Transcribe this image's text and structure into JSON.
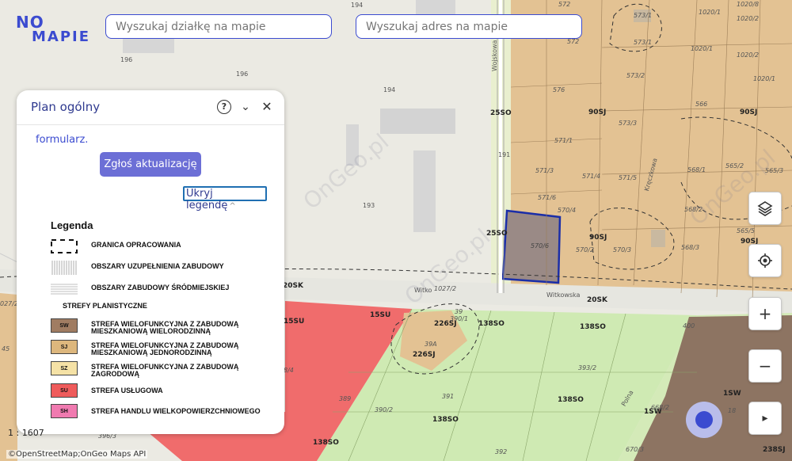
{
  "logo": {
    "top": "NO",
    "bottom": "MAPIE"
  },
  "search": {
    "plot_placeholder": "Wyszukaj działkę na mapie",
    "address_placeholder": "Wyszukaj adres na mapie"
  },
  "panel": {
    "title": "Plan ogólny",
    "help_icon": "?",
    "chevron_icon": "⌄",
    "close_icon": "✕",
    "formularz": "formularz.",
    "report_button": "Zgłoś aktualizację",
    "hide_legend": "Ukryj legendę",
    "hide_legend_chev": "^",
    "legend": {
      "title": "Legenda",
      "items": [
        {
          "label": "GRANICA OPRACOWANIA"
        },
        {
          "label": "OBSZARY UZUPEŁNIENIA ZABUDOWY"
        },
        {
          "label": "OBSZARY ZABUDOWY ŚRÓDMIEJSKIEJ"
        }
      ],
      "subheader": "STREFY PLANISTYCZNE",
      "zones": [
        {
          "code": "SW",
          "color": "#a07c62",
          "line1": "STREFA WIELOFUNKCYJNA Z ZABUDOWĄ",
          "line2": "MIESZKANIOWĄ WIELORODZINNĄ"
        },
        {
          "code": "SJ",
          "color": "#ddb77d",
          "line1": "STREFA WIELOFUNKCYJNA Z ZABUDOWĄ",
          "line2": "MIESZKANIOWĄ JEDNORODZINNĄ"
        },
        {
          "code": "SZ",
          "color": "#f5e2a6",
          "line1": "STREFA WIELOFUNKCYJNA Z ZABUDOWĄ",
          "line2": "ZAGRODOWĄ"
        },
        {
          "code": "SU",
          "color": "#ef5b5b",
          "line1": "STREFA USŁUGOWA",
          "line2": ""
        },
        {
          "code": "SH",
          "color": "#f07ab0",
          "line1": "STREFA HANDLU WIELKOPOWIERZCHNIOWEGO",
          "line2": ""
        }
      ]
    }
  },
  "tools": {
    "layers_icon": "layers-icon",
    "locate_icon": "locate-icon",
    "zoom_in": "+",
    "zoom_out": "−",
    "expand": "▸"
  },
  "scale": "1 : 1607",
  "attribution": "©OpenStreetMap;OnGeo Maps API",
  "map_labels": {
    "p194a": "194",
    "p196a": "196",
    "p196b": "196",
    "p194b": "194",
    "p193": "193",
    "p191": "191",
    "p572": "572",
    "p572b": "572",
    "p576": "576",
    "p571_1": "571/1",
    "p571_3": "571/3",
    "p571_4": "571/4",
    "p571_5": "571/5",
    "p571_6": "571/6",
    "p570_4": "570/4",
    "p570_6": "570/6",
    "p570_2": "570/2",
    "p570_3": "570/3",
    "p573_1": "573/1",
    "p573_1b": "573/1",
    "p573_2": "573/2",
    "p573_3": "573/3",
    "p566": "566",
    "p568_1": "568/1",
    "p568_2": "568/2",
    "p568_3": "568/3",
    "p565_2": "565/2",
    "p565_3": "565/3",
    "p565_5": "565/5",
    "p1020_1": "1020/1",
    "p1020_2": "1020/2",
    "p1020_8": "1020/8",
    "p1020_1b": "1020/1",
    "p1020_2b": "1020/2",
    "p1020_1c": "1020/1",
    "z25so_a": "25SO",
    "z25so_b": "25SO",
    "z90sj_a": "90SJ",
    "z90sj_b": "90SJ",
    "z90sj_c": "90SJ",
    "z90sj_d": "90SJ",
    "z20sk_a": "20SK",
    "z20sk_b": "20SK",
    "z15su_a": "15SU",
    "z15su_b": "15SU",
    "z226sj_a": "226SJ",
    "z226sj_b": "226SJ",
    "z138so_a": "138SO",
    "z138so_b": "138SO",
    "z138so_c": "138SO",
    "z138so_d": "138SO",
    "z138so_e": "138SO",
    "z1sw_a": "1SW",
    "z1sw_b": "1SW",
    "z238sj": "238SJ",
    "p1027_2": "1027/2",
    "p39": "39",
    "p390_1": "390/1",
    "p39a": "39A",
    "p393_2": "393/2",
    "p391": "391",
    "p390_2": "390/2",
    "p389": "389",
    "p392": "392",
    "p396_3": "396/3",
    "p400": "400",
    "p668_2": "668/2",
    "p18": "18",
    "p670_3": "670/3",
    "p45": "45",
    "p027_2": "027/2",
    "p8_4": "8/4",
    "s_wojskowa": "Wojskowa",
    "s_witkowska": "Witkowska",
    "s_witko": "Witko",
    "s_kreczkowa": "Kręczkowa",
    "s_polna": "Polna",
    "wm1": "OnGeo.pl",
    "wm2": "OnGeo.pl",
    "wm3": "OnGeo.pl"
  }
}
